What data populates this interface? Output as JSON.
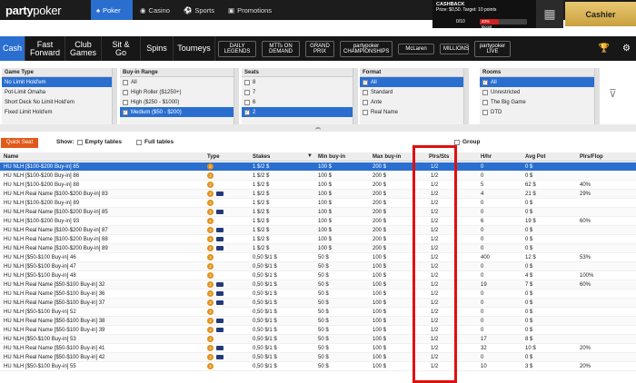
{
  "brand": {
    "name_left": "party",
    "name_right": "poker"
  },
  "top_tabs": [
    {
      "label": "Poker",
      "active": true
    },
    {
      "label": "Casino",
      "active": false
    },
    {
      "label": "Sports",
      "active": false
    },
    {
      "label": "Promotions",
      "active": false
    }
  ],
  "cashback": {
    "title": "CASHBACK",
    "prize": "Prize: $0,50. Target: 10 points",
    "boost": "40% Boost",
    "progress": "0/10",
    "progress_fraction": 0.4
  },
  "cashier": "Cashier",
  "nav": [
    {
      "label": "Cash",
      "active": true
    },
    {
      "label": "Fast Forward"
    },
    {
      "label": "Club Games"
    },
    {
      "label": "Sit & Go"
    },
    {
      "label": "Spins"
    },
    {
      "label": "Tourneys"
    }
  ],
  "promos": [
    "DAILY LEGENDS",
    "MTTs ON DEMAND",
    "GRAND PRIX",
    "partypoker CHAMPIONSHIPS",
    "McLaren",
    "MILLIONS",
    "partypoker LIVE"
  ],
  "filters": {
    "game_type": {
      "header": "Game Type",
      "items": [
        "No Limit Hold'em",
        "Pot-Limit Omaha",
        "Short Deck No Limit Hold'em",
        "Fixed Limit Hold'em"
      ],
      "selected": 0
    },
    "buy_in": {
      "header": "Buy-in Range",
      "items": [
        {
          "label": "All",
          "checked": false
        },
        {
          "label": "High Roller ($1250+)",
          "checked": false
        },
        {
          "label": "High ($250 - $1000)",
          "checked": false
        },
        {
          "label": "Medium ($50 - $200)",
          "checked": true
        }
      ]
    },
    "seats": {
      "header": "Seats",
      "items": [
        {
          "label": "8",
          "checked": false
        },
        {
          "label": "7",
          "checked": false
        },
        {
          "label": "6",
          "checked": false
        },
        {
          "label": "2",
          "checked": true
        }
      ]
    },
    "format": {
      "header": "Format",
      "items": [
        {
          "label": "All",
          "checked": true
        },
        {
          "label": "Standard",
          "checked": false
        },
        {
          "label": "Ante",
          "checked": false
        },
        {
          "label": "Real Name",
          "checked": false
        }
      ]
    },
    "rooms": {
      "header": "Rooms",
      "items": [
        {
          "label": "All",
          "checked": true
        },
        {
          "label": "Unrestricted",
          "checked": false
        },
        {
          "label": "The Big Game",
          "checked": false
        },
        {
          "label": "DTD",
          "checked": false
        }
      ]
    }
  },
  "options": {
    "quick_seat": "Quick Seat",
    "show": "Show:",
    "empty_tables": "Empty tables",
    "full_tables": "Full tables",
    "group": "Group"
  },
  "columns": [
    "Name",
    "Type",
    "Stakes",
    "Min buy-in",
    "Max buy-in",
    "Plrs/Sts",
    "H/hr",
    "Avg Pot",
    "Plrs/Flop"
  ],
  "rows": [
    {
      "name": "HU NLH [$100-$200 Buy-in] 85",
      "real": false,
      "stakes": "1 $/2 $",
      "min": "100 $",
      "max": "200 $",
      "plrs": "1/2",
      "hhr": "0",
      "pot": "0 $",
      "flop": ""
    },
    {
      "name": "HU NLH [$100-$200 Buy-in] 86",
      "real": false,
      "stakes": "1 $/2 $",
      "min": "100 $",
      "max": "200 $",
      "plrs": "1/2",
      "hhr": "0",
      "pot": "0 $",
      "flop": ""
    },
    {
      "name": "HU NLH [$100-$200 Buy-in] 88",
      "real": false,
      "stakes": "1 $/2 $",
      "min": "100 $",
      "max": "200 $",
      "plrs": "1/2",
      "hhr": "5",
      "pot": "62 $",
      "flop": "40%"
    },
    {
      "name": "HU NLH Real Name [$100-$200 Buy-in] 83",
      "real": true,
      "stakes": "1 $/2 $",
      "min": "100 $",
      "max": "200 $",
      "plrs": "1/2",
      "hhr": "4",
      "pot": "21 $",
      "flop": "29%"
    },
    {
      "name": "HU NLH [$100-$200 Buy-in] 89",
      "real": false,
      "stakes": "1 $/2 $",
      "min": "100 $",
      "max": "200 $",
      "plrs": "1/2",
      "hhr": "0",
      "pot": "0 $",
      "flop": ""
    },
    {
      "name": "HU NLH Real Name [$100-$200 Buy-in] 85",
      "real": true,
      "stakes": "1 $/2 $",
      "min": "100 $",
      "max": "200 $",
      "plrs": "1/2",
      "hhr": "0",
      "pot": "0 $",
      "flop": ""
    },
    {
      "name": "HU NLH [$100-$200 Buy-in] 93",
      "real": false,
      "stakes": "1 $/2 $",
      "min": "100 $",
      "max": "200 $",
      "plrs": "1/2",
      "hhr": "6",
      "pot": "19 $",
      "flop": "60%"
    },
    {
      "name": "HU NLH Real Name [$100-$200 Buy-in] 87",
      "real": true,
      "stakes": "1 $/2 $",
      "min": "100 $",
      "max": "200 $",
      "plrs": "1/2",
      "hhr": "0",
      "pot": "0 $",
      "flop": ""
    },
    {
      "name": "HU NLH Real Name [$100-$200 Buy-in] 88",
      "real": true,
      "stakes": "1 $/2 $",
      "min": "100 $",
      "max": "200 $",
      "plrs": "1/2",
      "hhr": "0",
      "pot": "0 $",
      "flop": ""
    },
    {
      "name": "HU NLH Real Name [$100-$200 Buy-in] 89",
      "real": true,
      "stakes": "1 $/2 $",
      "min": "100 $",
      "max": "200 $",
      "plrs": "1/2",
      "hhr": "0",
      "pot": "0 $",
      "flop": ""
    },
    {
      "name": "HU NLH [$50-$100 Buy-in] 46",
      "real": false,
      "stakes": "0,50 $/1 $",
      "min": "50 $",
      "max": "100 $",
      "plrs": "1/2",
      "hhr": "400",
      "pot": "12 $",
      "flop": "53%"
    },
    {
      "name": "HU NLH [$50-$100 Buy-in] 47",
      "real": false,
      "stakes": "0,50 $/1 $",
      "min": "50 $",
      "max": "100 $",
      "plrs": "1/2",
      "hhr": "0",
      "pot": "0 $",
      "flop": ""
    },
    {
      "name": "HU NLH [$50-$100 Buy-in] 48",
      "real": false,
      "stakes": "0,50 $/1 $",
      "min": "50 $",
      "max": "100 $",
      "plrs": "1/2",
      "hhr": "0",
      "pot": "4 $",
      "flop": "100%"
    },
    {
      "name": "HU NLH Real Name [$50-$100 Buy-in] 32",
      "real": true,
      "stakes": "0,50 $/1 $",
      "min": "50 $",
      "max": "100 $",
      "plrs": "1/2",
      "hhr": "19",
      "pot": "7 $",
      "flop": "60%"
    },
    {
      "name": "HU NLH Real Name [$50-$100 Buy-in] 36",
      "real": true,
      "stakes": "0,50 $/1 $",
      "min": "50 $",
      "max": "100 $",
      "plrs": "1/2",
      "hhr": "0",
      "pot": "0 $",
      "flop": ""
    },
    {
      "name": "HU NLH Real Name [$50-$100 Buy-in] 37",
      "real": true,
      "stakes": "0,50 $/1 $",
      "min": "50 $",
      "max": "100 $",
      "plrs": "1/2",
      "hhr": "0",
      "pot": "0 $",
      "flop": ""
    },
    {
      "name": "HU NLH [$50-$100 Buy-in] 52",
      "real": false,
      "stakes": "0,50 $/1 $",
      "min": "50 $",
      "max": "100 $",
      "plrs": "1/2",
      "hhr": "0",
      "pot": "0 $",
      "flop": ""
    },
    {
      "name": "HU NLH Real Name [$50-$100 Buy-in] 38",
      "real": true,
      "stakes": "0,50 $/1 $",
      "min": "50 $",
      "max": "100 $",
      "plrs": "1/2",
      "hhr": "0",
      "pot": "0 $",
      "flop": ""
    },
    {
      "name": "HU NLH Real Name [$50-$100 Buy-in] 39",
      "real": true,
      "stakes": "0,50 $/1 $",
      "min": "50 $",
      "max": "100 $",
      "plrs": "1/2",
      "hhr": "0",
      "pot": "0 $",
      "flop": ""
    },
    {
      "name": "HU NLH [$50-$100 Buy-in] 53",
      "real": false,
      "stakes": "0,50 $/1 $",
      "min": "50 $",
      "max": "100 $",
      "plrs": "1/2",
      "hhr": "17",
      "pot": "8 $",
      "flop": ""
    },
    {
      "name": "HU NLH Real Name [$50-$100 Buy-in] 41",
      "real": true,
      "stakes": "0,50 $/1 $",
      "min": "50 $",
      "max": "100 $",
      "plrs": "1/2",
      "hhr": "32",
      "pot": "10 $",
      "flop": "20%"
    },
    {
      "name": "HU NLH Real Name [$50-$100 Buy-in] 42",
      "real": true,
      "stakes": "0,50 $/1 $",
      "min": "50 $",
      "max": "100 $",
      "plrs": "1/2",
      "hhr": "0",
      "pot": "0 $",
      "flop": ""
    },
    {
      "name": "HU NLH [$50-$100 Buy-in] 55",
      "real": false,
      "stakes": "0,50 $/1 $",
      "min": "50 $",
      "max": "100 $",
      "plrs": "1/2",
      "hhr": "10",
      "pot": "3 $",
      "flop": "20%"
    }
  ],
  "colors": {
    "accent": "#2a6fd0",
    "highlight_box": "#e01010",
    "coin": "#e0911a",
    "quick_seat": "#e05a1a"
  }
}
